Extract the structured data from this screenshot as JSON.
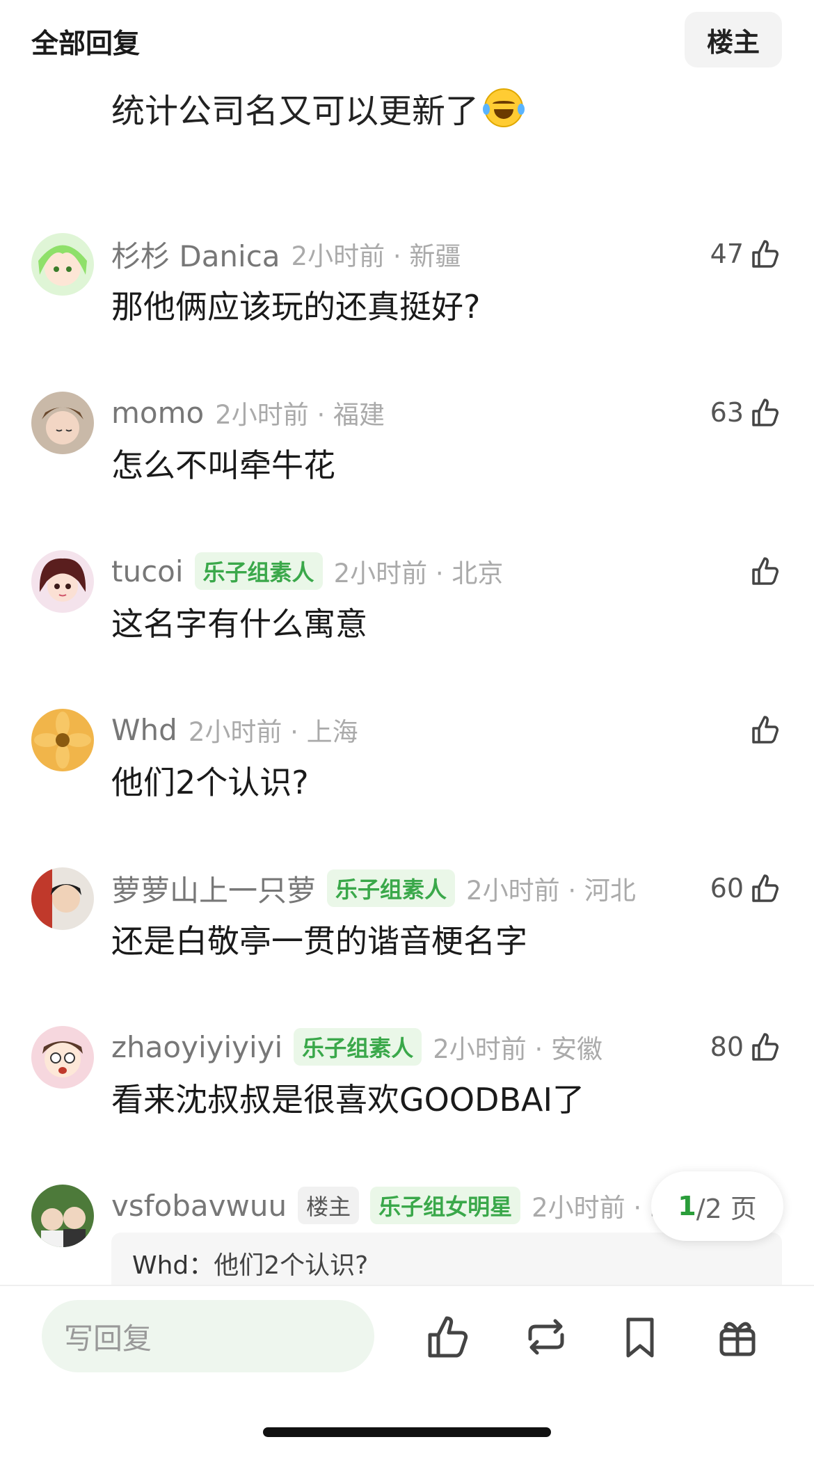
{
  "header": {
    "title": "全部回复",
    "louzhu_button": "楼主"
  },
  "top_comment": {
    "text": "统计公司名又可以更新了"
  },
  "comments": [
    {
      "name": "杉杉 Danica",
      "badges": [],
      "time": "2小时前 · 新疆",
      "likes": "47",
      "text": "那他俩应该玩的还真挺好?"
    },
    {
      "name": "momo",
      "badges": [],
      "time": "2小时前 · 福建",
      "likes": "63",
      "text": "怎么不叫牵牛花"
    },
    {
      "name": "tucoi",
      "badges": [
        "乐子组素人"
      ],
      "time": "2小时前 · 北京",
      "likes": "",
      "text": "这名字有什么寓意"
    },
    {
      "name": "Whd",
      "badges": [],
      "time": "2小时前 · 上海",
      "likes": "",
      "text": "他们2个认识?"
    },
    {
      "name": "萝萝山上一只萝",
      "badges": [
        "乐子组素人"
      ],
      "time": "2小时前 · 河北",
      "likes": "60",
      "text": "还是白敬亭一贯的谐音梗名字"
    },
    {
      "name": "zhaoyiyiyiyi",
      "badges": [
        "乐子组素人"
      ],
      "time": "2小时前 · 安徽",
      "likes": "80",
      "text": "看来沈叔叔是很喜欢GOODBAI了"
    },
    {
      "name": "vsfobavwuu",
      "badges": [
        "楼主",
        "乐子组女明星"
      ],
      "time": "2小时前 · 5",
      "likes": "",
      "text": ""
    }
  ],
  "quote": {
    "name": "Whd：",
    "text": "他们2个认识?"
  },
  "pager": {
    "current": "1",
    "total": "/2 页"
  },
  "bottom": {
    "reply_placeholder": "写回复"
  },
  "colors": {
    "accent_green": "#3aa84a",
    "badge_bg": "#eaf7e8",
    "reply_bg": "#eef6ee"
  }
}
